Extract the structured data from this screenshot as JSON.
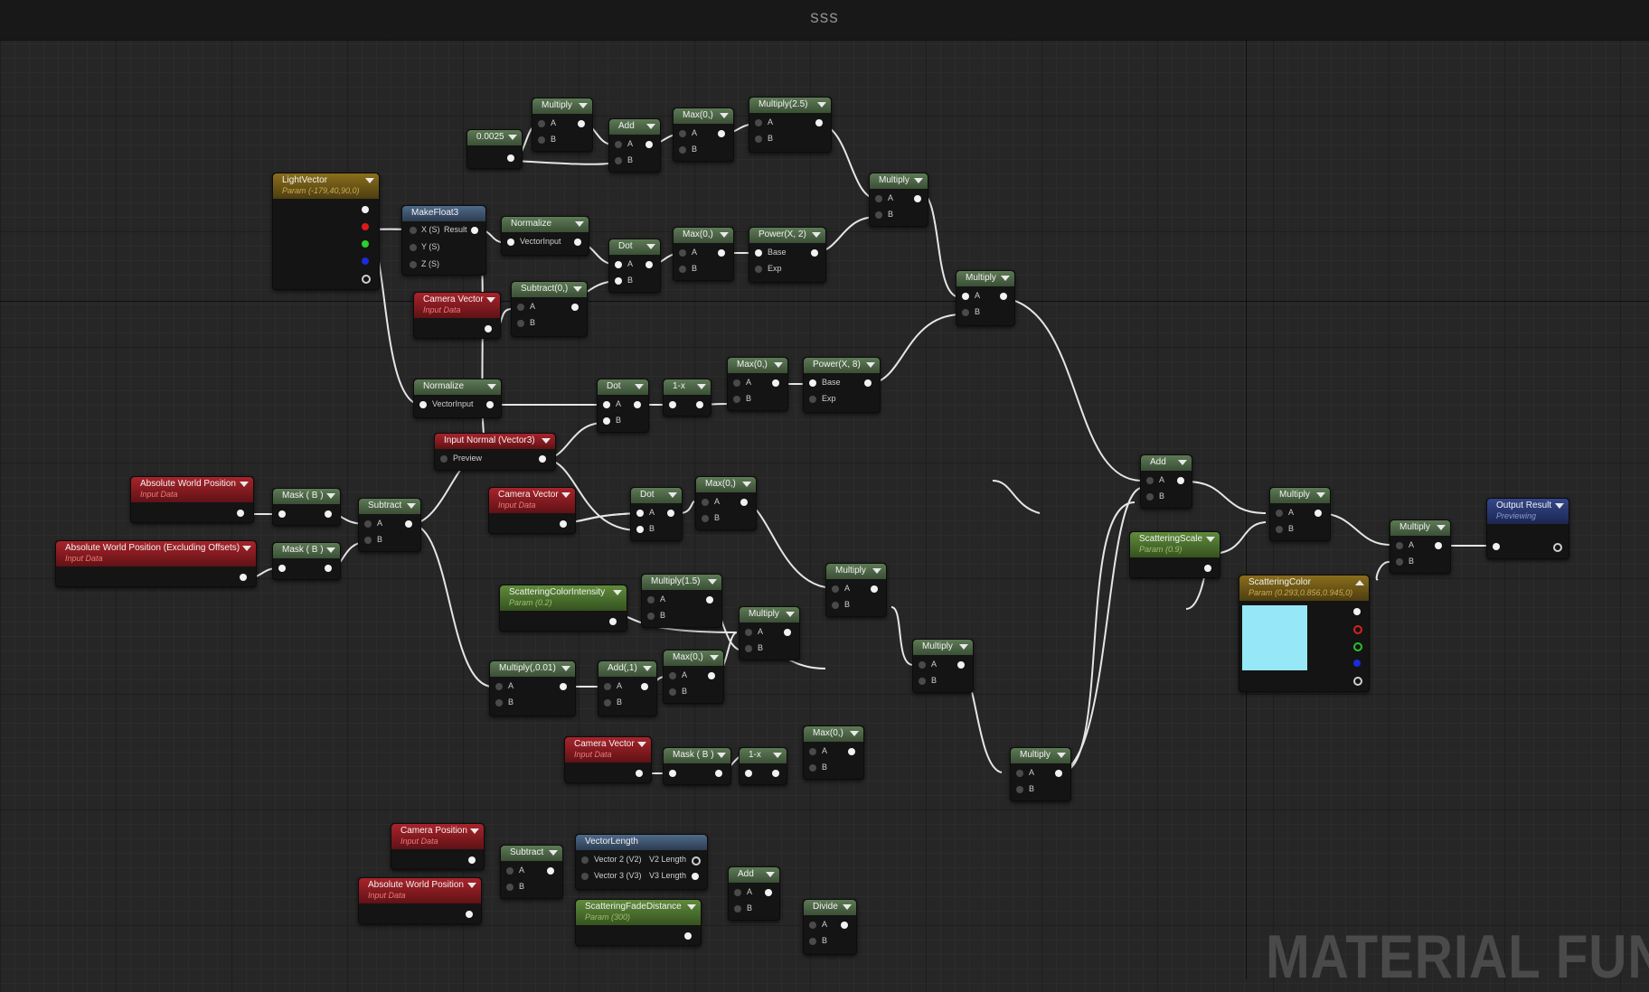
{
  "title": "sss",
  "watermark": "MATERIAL FUNC",
  "nodes": {
    "mul_top": {
      "title": "Multiply",
      "pins_in": [
        "A",
        "B"
      ]
    },
    "c0025": {
      "title": "0.0025"
    },
    "add_top": {
      "title": "Add",
      "pins_in": [
        "A",
        "B"
      ]
    },
    "max_top": {
      "title": "Max(0,)",
      "pins_in": [
        "A",
        "B"
      ]
    },
    "mul25": {
      "title": "Multiply(2.5)",
      "pins_in": [
        "A",
        "B"
      ]
    },
    "lightvec": {
      "title": "LightVector",
      "subtitle": "Param (-179,40,90,0)"
    },
    "makefloat3": {
      "title": "MakeFloat3",
      "pins_in": [
        "X (S)",
        "Y (S)",
        "Z (S)"
      ],
      "pin_out": "Result"
    },
    "normalize1": {
      "title": "Normalize",
      "pins_in": [
        "VectorInput"
      ]
    },
    "dot1": {
      "title": "Dot",
      "pins_in": [
        "A",
        "B"
      ]
    },
    "max2": {
      "title": "Max(0,)",
      "pins_in": [
        "A",
        "B"
      ]
    },
    "power2": {
      "title": "Power(X, 2)",
      "pins_in": [
        "Base",
        "Exp"
      ]
    },
    "mul_r1": {
      "title": "Multiply",
      "pins_in": [
        "A",
        "B"
      ]
    },
    "camvec1": {
      "title": "Camera Vector",
      "subtitle": "Input Data"
    },
    "sub01": {
      "title": "Subtract(0,)",
      "pins_in": [
        "A",
        "B"
      ]
    },
    "mul_r2": {
      "title": "Multiply",
      "pins_in": [
        "A",
        "B"
      ]
    },
    "normalize2": {
      "title": "Normalize",
      "pins_in": [
        "VectorInput"
      ]
    },
    "dot2": {
      "title": "Dot",
      "pins_in": [
        "A",
        "B"
      ]
    },
    "onex1": {
      "title": "1-x"
    },
    "max3": {
      "title": "Max(0,)",
      "pins_in": [
        "A",
        "B"
      ]
    },
    "power8": {
      "title": "Power(X, 8)",
      "pins_in": [
        "Base",
        "Exp"
      ]
    },
    "inputnormal": {
      "title": "Input Normal (Vector3)",
      "pins_in": [
        "Preview"
      ]
    },
    "awp1": {
      "title": "Absolute World Position",
      "subtitle": "Input Data"
    },
    "maskb1": {
      "title": "Mask ( B )"
    },
    "subtract1": {
      "title": "Subtract",
      "pins_in": [
        "A",
        "B"
      ]
    },
    "camvec2": {
      "title": "Camera Vector",
      "subtitle": "Input Data"
    },
    "dot3": {
      "title": "Dot",
      "pins_in": [
        "A",
        "B"
      ]
    },
    "max4": {
      "title": "Max(0,)",
      "pins_in": [
        "A",
        "B"
      ]
    },
    "awp_ex": {
      "title": "Absolute World Position (Excluding Offsets)",
      "subtitle": "Input Data"
    },
    "maskb2": {
      "title": "Mask ( B )"
    },
    "add_mid": {
      "title": "Add",
      "pins_in": [
        "A",
        "B"
      ]
    },
    "scatscale": {
      "title": "ScatteringScale",
      "subtitle": "Param (0.9)"
    },
    "mul_m1": {
      "title": "Multiply",
      "pins_in": [
        "A",
        "B"
      ]
    },
    "mul_m2": {
      "title": "Multiply",
      "pins_in": [
        "A",
        "B"
      ]
    },
    "output": {
      "title": "Output Result",
      "subtitle": "Previewing"
    },
    "scatcolor": {
      "title": "ScatteringColor",
      "subtitle": "Param (0.293,0.856,0.945,0)",
      "swatch": "#96e8f8"
    },
    "mul_c1": {
      "title": "Multiply",
      "pins_in": [
        "A",
        "B"
      ]
    },
    "scatcolint": {
      "title": "ScatteringColorIntensity",
      "subtitle": "Param (0.2)"
    },
    "mul15": {
      "title": "Multiply(1.5)",
      "pins_in": [
        "A",
        "B"
      ]
    },
    "mul_c2": {
      "title": "Multiply",
      "pins_in": [
        "A",
        "B"
      ]
    },
    "mul001": {
      "title": "Multiply(,0.01)",
      "pins_in": [
        "A",
        "B"
      ]
    },
    "add1": {
      "title": "Add(,1)",
      "pins_in": [
        "A",
        "B"
      ]
    },
    "max5": {
      "title": "Max(0,)",
      "pins_in": [
        "A",
        "B"
      ]
    },
    "mul_c3": {
      "title": "Multiply",
      "pins_in": [
        "A",
        "B"
      ]
    },
    "camvec3": {
      "title": "Camera Vector",
      "subtitle": "Input Data"
    },
    "maskb3": {
      "title": "Mask ( B )"
    },
    "onex2": {
      "title": "1-x"
    },
    "max6": {
      "title": "Max(0,)",
      "pins_in": [
        "A",
        "B"
      ]
    },
    "mul_c4": {
      "title": "Multiply",
      "pins_in": [
        "A",
        "B"
      ]
    },
    "campos": {
      "title": "Camera Position",
      "subtitle": "Input Data"
    },
    "subtract2": {
      "title": "Subtract",
      "pins_in": [
        "A",
        "B"
      ]
    },
    "veclen": {
      "title": "VectorLength",
      "pins_in": [
        "Vector 2 (V2)",
        "Vector 3 (V3)"
      ],
      "pins_out": [
        "V2 Length",
        "V3 Length"
      ]
    },
    "awp2": {
      "title": "Absolute World Position",
      "subtitle": "Input Data"
    },
    "add_bot": {
      "title": "Add",
      "pins_in": [
        "A",
        "B"
      ]
    },
    "scatfade": {
      "title": "ScatteringFadeDistance",
      "subtitle": "Param (300)"
    },
    "divide": {
      "title": "Divide",
      "pins_in": [
        "A",
        "B"
      ]
    }
  }
}
